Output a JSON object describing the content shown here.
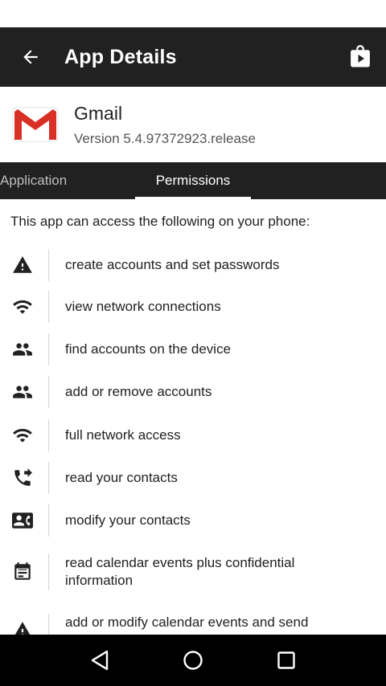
{
  "app_bar": {
    "title": "App Details",
    "back_icon": "arrow-left-icon",
    "store_icon": "play-store-icon"
  },
  "app": {
    "name": "Gmail",
    "version": "Version 5.4.97372923.release",
    "icon": "gmail-icon"
  },
  "tabs": [
    {
      "label": "Application",
      "selected": false
    },
    {
      "label": "Permissions",
      "selected": true
    }
  ],
  "permissions": {
    "intro": "This app can access the following on your phone:",
    "items": [
      {
        "icon": "warning-icon",
        "label": "create accounts and set passwords"
      },
      {
        "icon": "wifi-icon",
        "label": "view network connections"
      },
      {
        "icon": "people-icon",
        "label": "find accounts on the device"
      },
      {
        "icon": "people-icon",
        "label": "add or remove accounts"
      },
      {
        "icon": "wifi-icon",
        "label": "full network access"
      },
      {
        "icon": "phone-forward-icon",
        "label": "read your contacts"
      },
      {
        "icon": "contact-card-icon",
        "label": "modify your contacts"
      },
      {
        "icon": "calendar-icon",
        "label": "read calendar events plus confidential information"
      },
      {
        "icon": "warning-icon",
        "label": "add or modify calendar events and send"
      }
    ]
  },
  "nav_bar": {
    "back": "nav-back-icon",
    "home": "nav-home-icon",
    "recents": "nav-recents-icon"
  },
  "colors": {
    "app_bar": "#212121",
    "gmail_red": "#d93025",
    "divider": "#d6d6d6"
  }
}
